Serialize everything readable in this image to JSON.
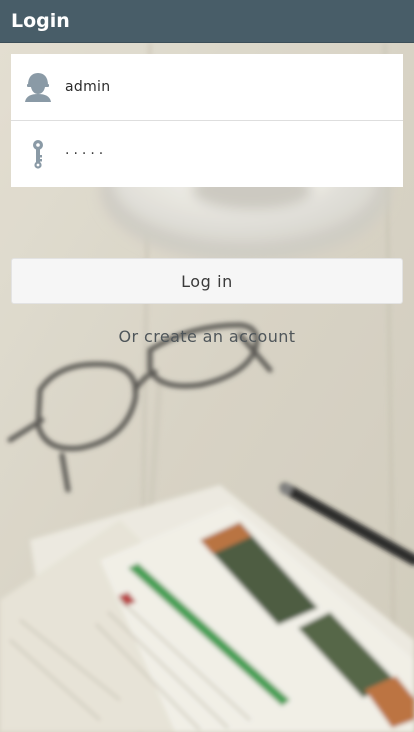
{
  "header": {
    "title": "Login"
  },
  "form": {
    "username": {
      "icon": "user-icon",
      "value": "admin"
    },
    "password": {
      "icon": "key-icon",
      "value": "·····"
    }
  },
  "actions": {
    "login_label": "Log in",
    "create_account_label": "Or create an account"
  },
  "colors": {
    "header_bg": "#485d68",
    "header_text": "#ffffff",
    "icon": "#8a9aa6",
    "card_bg": "#ffffff",
    "button_bg": "#f6f6f6"
  }
}
